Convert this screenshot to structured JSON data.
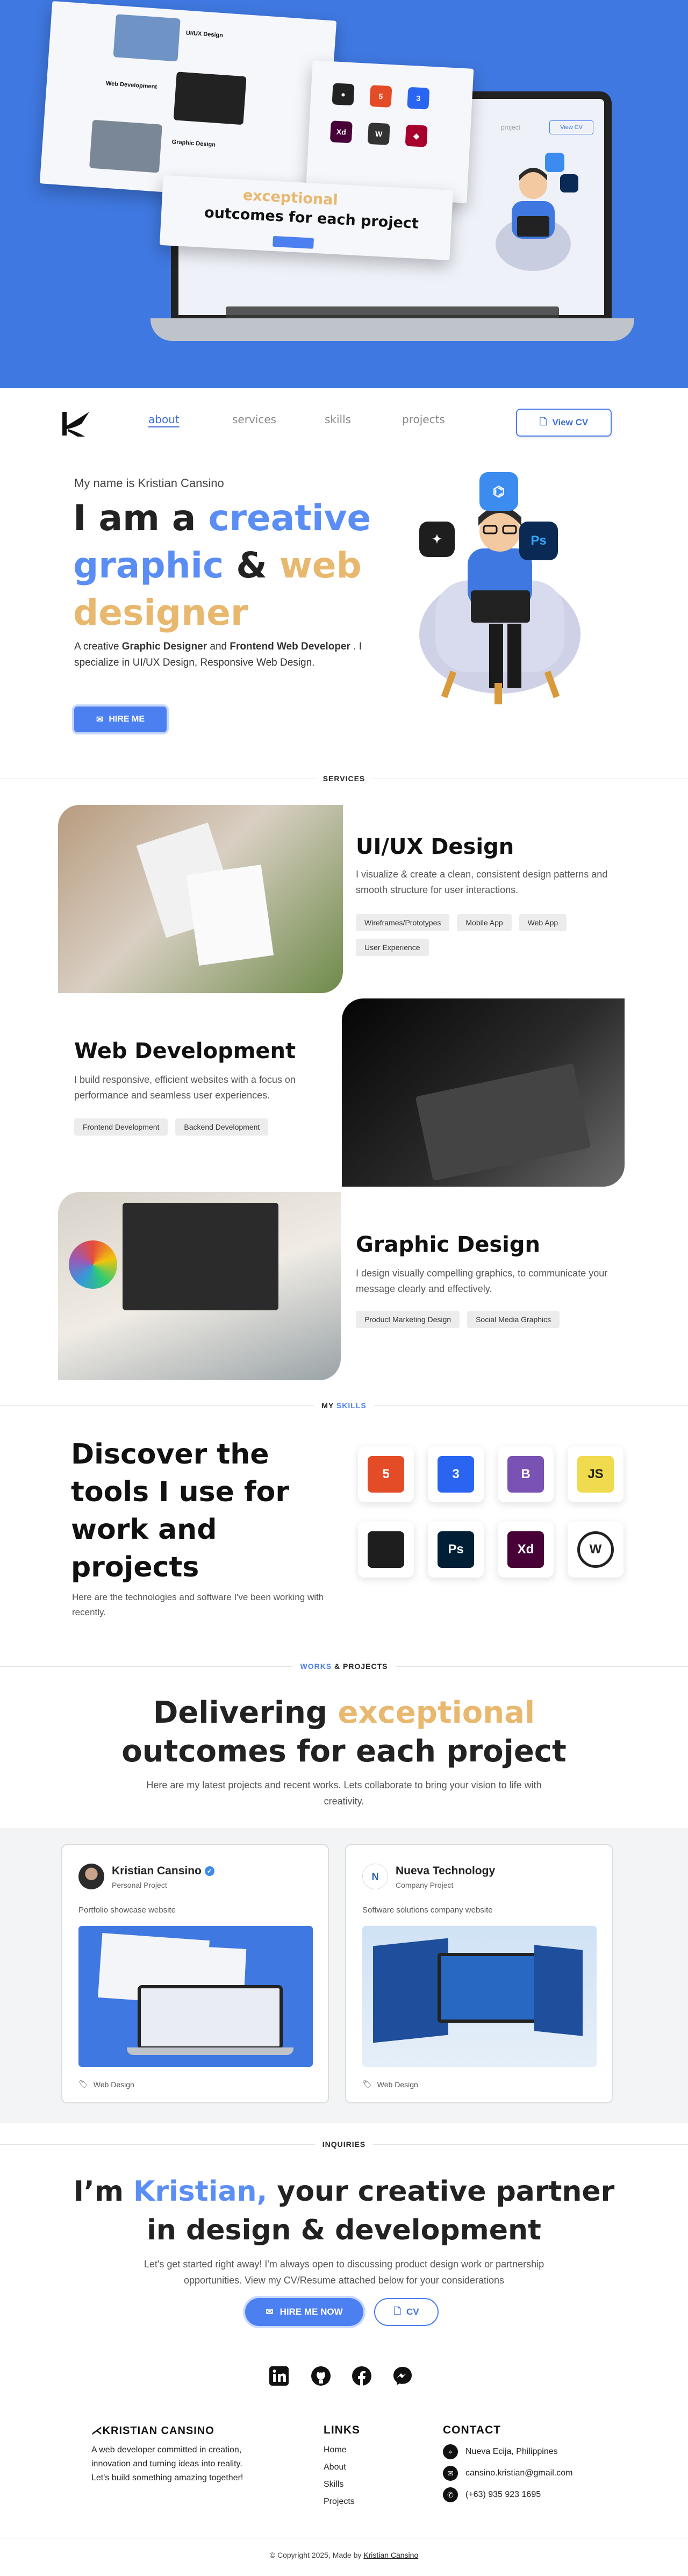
{
  "hero": {
    "card1_item1": "UI/UX Design",
    "card1_item2": "Web Development",
    "card1_item3": "Graphic Design",
    "headline_line1_orange": "exceptional",
    "headline_line2": "outcomes for each project",
    "laptop_nav": "project",
    "laptop_cv": "View CV"
  },
  "nav": {
    "links": [
      "about",
      "services",
      "skills",
      "projects"
    ],
    "cv_label": "View CV"
  },
  "intro": {
    "greeting": "My name is Kristian Cansino",
    "h_part1": "I am a ",
    "h_highlight1": "creative",
    "h_part2": " graphic",
    "h_part3": " & ",
    "h_highlight2": "web",
    "h_highlight3": "designer",
    "p_part1": "A creative ",
    "p_bold1": "Graphic Designer",
    "p_part2": " and ",
    "p_bold2": "Frontend Web Developer",
    "p_part3": " . I specialize in UI/UX Design, Responsive Web Design.",
    "hire_label": "HIRE ME"
  },
  "services": {
    "label": "SERVICES",
    "items": [
      {
        "title": "UI/UX Design",
        "desc": "I visualize & create a clean, consistent design patterns and smooth structure for user interactions.",
        "tags": [
          "Wireframes/Prototypes",
          "Mobile App",
          "Web App",
          "User Experience"
        ]
      },
      {
        "title": "Web Development",
        "desc": "I build responsive, efficient websites with a focus on performance and seamless user experiences.",
        "tags": [
          "Frontend Development",
          "Backend Development"
        ]
      },
      {
        "title": "Graphic Design",
        "desc": "I design visually compelling graphics, to communicate your message clearly and effectively.",
        "tags": [
          "Product Marketing Design",
          "Social Media Graphics"
        ]
      }
    ]
  },
  "skills": {
    "label_my": "MY ",
    "label_skills": "SKILLS",
    "headline": "Discover the tools I use for work and projects",
    "desc": "Here are the technologies and software I've been working with recently.",
    "tiles": [
      {
        "icon": "html5-icon",
        "text": "5",
        "color": "#e34c26"
      },
      {
        "icon": "css3-icon",
        "text": "3",
        "color": "#2965f1"
      },
      {
        "icon": "bootstrap-icon",
        "text": "B",
        "color": "#7952b3"
      },
      {
        "icon": "javascript-icon",
        "text": "JS",
        "color": "#f0db4f"
      },
      {
        "icon": "figma-icon",
        "text": "",
        "color": "#1e1e1e"
      },
      {
        "icon": "photoshop-icon",
        "text": "Ps",
        "color": "#001e36"
      },
      {
        "icon": "xd-icon",
        "text": "Xd",
        "color": "#470137"
      },
      {
        "icon": "wordpress-icon",
        "text": "W",
        "color": "#ffffff"
      }
    ]
  },
  "projects": {
    "label_works": "WORKS",
    "label_rest": " & PROJECTS",
    "h_part1": "Delivering ",
    "h_highlight": "exceptional",
    "h_line2": "outcomes for each project",
    "desc": "Here are my latest projects and recent works. Lets collaborate to bring your vision to life with creativity.",
    "cards": [
      {
        "name": "Kristian Cansino",
        "type": "Personal Project",
        "desc": "Portfolio showcase website",
        "tag": "Web Design"
      },
      {
        "name": "Nueva Technology",
        "type": "Company Project",
        "desc": "Software solutions company website",
        "tag": "Web Design"
      }
    ]
  },
  "inquiries": {
    "label": "INQUIRIES",
    "h_part1": "I’m ",
    "h_highlight": "Kristian,",
    "h_part2": " your creative partner",
    "h_line2": "in design & development",
    "desc": "Let's get started right away! I'm always open to discussing product design work or partnership opportunities. View my CV/Resume attached below for your considerations",
    "hire_label": "HIRE ME NOW",
    "cv_label": "CV"
  },
  "footer": {
    "brand": "KRISTIAN CANSINO",
    "about": "A web developer committed in creation, innovation and turning ideas into reality. Let's build something amazing together!",
    "links_head": "LINKS",
    "links": [
      "Home",
      "About",
      "Skills",
      "Projects"
    ],
    "contact_head": "CONTACT",
    "location": "Nueva Ecija, Philippines",
    "email": "cansino.kristian@gmail.com",
    "phone": "(+63) 935 923 1695",
    "copyright": "© Copyright 2025, Made by ",
    "copyright_name": "Kristian Cansino"
  },
  "colors": {
    "accent": "#4c7ff0",
    "orange": "#e8b86f",
    "hero_bg": "#3f78e0"
  }
}
